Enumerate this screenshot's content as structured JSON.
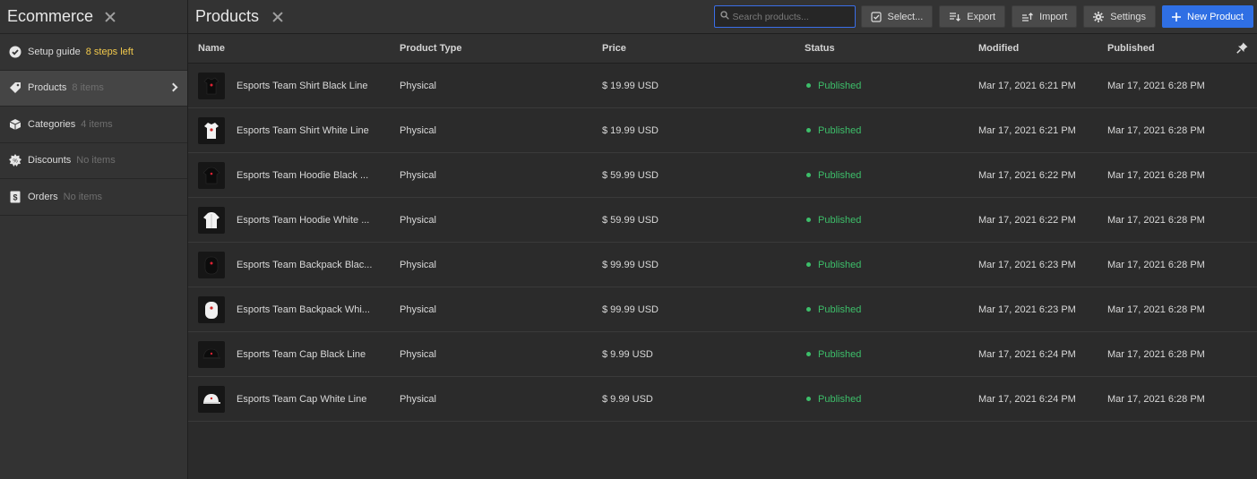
{
  "sidebar": {
    "title": "Ecommerce",
    "items": [
      {
        "label": "Setup guide",
        "badge": "8 steps left",
        "icon": "check-circle-icon"
      },
      {
        "label": "Products",
        "badge": "8 items",
        "icon": "tag-icon"
      },
      {
        "label": "Categories",
        "badge": "4 items",
        "icon": "box-icon"
      },
      {
        "label": "Discounts",
        "badge": "No items",
        "icon": "badge-gear-icon"
      },
      {
        "label": "Orders",
        "badge": "No items",
        "icon": "dollar-doc-icon"
      }
    ]
  },
  "header": {
    "title": "Products",
    "search_placeholder": "Search products...",
    "select_label": "Select...",
    "export_label": "Export",
    "import_label": "Import",
    "settings_label": "Settings",
    "new_label": "New Product"
  },
  "table": {
    "columns": [
      "Name",
      "Product Type",
      "Price",
      "Status",
      "Modified",
      "Published"
    ],
    "rows": [
      {
        "name": "Esports Team Shirt Black Line",
        "type": "Physical",
        "price": "$ 19.99 USD",
        "status": "Published",
        "modified": "Mar 17, 2021 6:21 PM",
        "published": "Mar 17, 2021 6:28 PM"
      },
      {
        "name": "Esports Team Shirt White Line",
        "type": "Physical",
        "price": "$ 19.99 USD",
        "status": "Published",
        "modified": "Mar 17, 2021 6:21 PM",
        "published": "Mar 17, 2021 6:28 PM"
      },
      {
        "name": "Esports Team Hoodie Black ...",
        "type": "Physical",
        "price": "$ 59.99 USD",
        "status": "Published",
        "modified": "Mar 17, 2021 6:22 PM",
        "published": "Mar 17, 2021 6:28 PM"
      },
      {
        "name": "Esports Team Hoodie White ...",
        "type": "Physical",
        "price": "$ 59.99 USD",
        "status": "Published",
        "modified": "Mar 17, 2021 6:22 PM",
        "published": "Mar 17, 2021 6:28 PM"
      },
      {
        "name": "Esports Team Backpack Blac...",
        "type": "Physical",
        "price": "$ 99.99 USD",
        "status": "Published",
        "modified": "Mar 17, 2021 6:23 PM",
        "published": "Mar 17, 2021 6:28 PM"
      },
      {
        "name": "Esports Team Backpack Whi...",
        "type": "Physical",
        "price": "$ 99.99 USD",
        "status": "Published",
        "modified": "Mar 17, 2021 6:23 PM",
        "published": "Mar 17, 2021 6:28 PM"
      },
      {
        "name": "Esports Team Cap Black Line",
        "type": "Physical",
        "price": "$ 9.99 USD",
        "status": "Published",
        "modified": "Mar 17, 2021 6:24 PM",
        "published": "Mar 17, 2021 6:28 PM"
      },
      {
        "name": "Esports Team Cap White Line",
        "type": "Physical",
        "price": "$ 9.99 USD",
        "status": "Published",
        "modified": "Mar 17, 2021 6:24 PM",
        "published": "Mar 17, 2021 6:28 PM"
      }
    ]
  },
  "colors": {
    "accent": "#2f6fe4",
    "published": "#3dbf6a",
    "warning": "#f2c94c"
  }
}
